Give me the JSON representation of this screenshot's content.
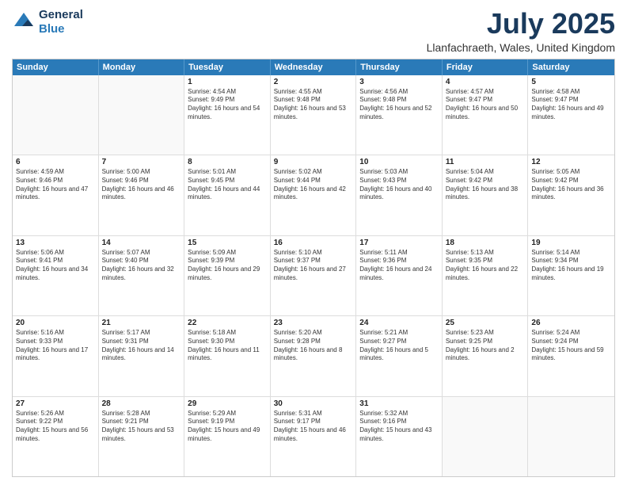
{
  "header": {
    "logo_line1": "General",
    "logo_line2": "Blue",
    "title": "July 2025",
    "subtitle": "Llanfachraeth, Wales, United Kingdom"
  },
  "weekdays": [
    "Sunday",
    "Monday",
    "Tuesday",
    "Wednesday",
    "Thursday",
    "Friday",
    "Saturday"
  ],
  "weeks": [
    [
      {
        "day": "",
        "sunrise": "",
        "sunset": "",
        "daylight": ""
      },
      {
        "day": "",
        "sunrise": "",
        "sunset": "",
        "daylight": ""
      },
      {
        "day": "1",
        "sunrise": "Sunrise: 4:54 AM",
        "sunset": "Sunset: 9:49 PM",
        "daylight": "Daylight: 16 hours and 54 minutes."
      },
      {
        "day": "2",
        "sunrise": "Sunrise: 4:55 AM",
        "sunset": "Sunset: 9:48 PM",
        "daylight": "Daylight: 16 hours and 53 minutes."
      },
      {
        "day": "3",
        "sunrise": "Sunrise: 4:56 AM",
        "sunset": "Sunset: 9:48 PM",
        "daylight": "Daylight: 16 hours and 52 minutes."
      },
      {
        "day": "4",
        "sunrise": "Sunrise: 4:57 AM",
        "sunset": "Sunset: 9:47 PM",
        "daylight": "Daylight: 16 hours and 50 minutes."
      },
      {
        "day": "5",
        "sunrise": "Sunrise: 4:58 AM",
        "sunset": "Sunset: 9:47 PM",
        "daylight": "Daylight: 16 hours and 49 minutes."
      }
    ],
    [
      {
        "day": "6",
        "sunrise": "Sunrise: 4:59 AM",
        "sunset": "Sunset: 9:46 PM",
        "daylight": "Daylight: 16 hours and 47 minutes."
      },
      {
        "day": "7",
        "sunrise": "Sunrise: 5:00 AM",
        "sunset": "Sunset: 9:46 PM",
        "daylight": "Daylight: 16 hours and 46 minutes."
      },
      {
        "day": "8",
        "sunrise": "Sunrise: 5:01 AM",
        "sunset": "Sunset: 9:45 PM",
        "daylight": "Daylight: 16 hours and 44 minutes."
      },
      {
        "day": "9",
        "sunrise": "Sunrise: 5:02 AM",
        "sunset": "Sunset: 9:44 PM",
        "daylight": "Daylight: 16 hours and 42 minutes."
      },
      {
        "day": "10",
        "sunrise": "Sunrise: 5:03 AM",
        "sunset": "Sunset: 9:43 PM",
        "daylight": "Daylight: 16 hours and 40 minutes."
      },
      {
        "day": "11",
        "sunrise": "Sunrise: 5:04 AM",
        "sunset": "Sunset: 9:42 PM",
        "daylight": "Daylight: 16 hours and 38 minutes."
      },
      {
        "day": "12",
        "sunrise": "Sunrise: 5:05 AM",
        "sunset": "Sunset: 9:42 PM",
        "daylight": "Daylight: 16 hours and 36 minutes."
      }
    ],
    [
      {
        "day": "13",
        "sunrise": "Sunrise: 5:06 AM",
        "sunset": "Sunset: 9:41 PM",
        "daylight": "Daylight: 16 hours and 34 minutes."
      },
      {
        "day": "14",
        "sunrise": "Sunrise: 5:07 AM",
        "sunset": "Sunset: 9:40 PM",
        "daylight": "Daylight: 16 hours and 32 minutes."
      },
      {
        "day": "15",
        "sunrise": "Sunrise: 5:09 AM",
        "sunset": "Sunset: 9:39 PM",
        "daylight": "Daylight: 16 hours and 29 minutes."
      },
      {
        "day": "16",
        "sunrise": "Sunrise: 5:10 AM",
        "sunset": "Sunset: 9:37 PM",
        "daylight": "Daylight: 16 hours and 27 minutes."
      },
      {
        "day": "17",
        "sunrise": "Sunrise: 5:11 AM",
        "sunset": "Sunset: 9:36 PM",
        "daylight": "Daylight: 16 hours and 24 minutes."
      },
      {
        "day": "18",
        "sunrise": "Sunrise: 5:13 AM",
        "sunset": "Sunset: 9:35 PM",
        "daylight": "Daylight: 16 hours and 22 minutes."
      },
      {
        "day": "19",
        "sunrise": "Sunrise: 5:14 AM",
        "sunset": "Sunset: 9:34 PM",
        "daylight": "Daylight: 16 hours and 19 minutes."
      }
    ],
    [
      {
        "day": "20",
        "sunrise": "Sunrise: 5:16 AM",
        "sunset": "Sunset: 9:33 PM",
        "daylight": "Daylight: 16 hours and 17 minutes."
      },
      {
        "day": "21",
        "sunrise": "Sunrise: 5:17 AM",
        "sunset": "Sunset: 9:31 PM",
        "daylight": "Daylight: 16 hours and 14 minutes."
      },
      {
        "day": "22",
        "sunrise": "Sunrise: 5:18 AM",
        "sunset": "Sunset: 9:30 PM",
        "daylight": "Daylight: 16 hours and 11 minutes."
      },
      {
        "day": "23",
        "sunrise": "Sunrise: 5:20 AM",
        "sunset": "Sunset: 9:28 PM",
        "daylight": "Daylight: 16 hours and 8 minutes."
      },
      {
        "day": "24",
        "sunrise": "Sunrise: 5:21 AM",
        "sunset": "Sunset: 9:27 PM",
        "daylight": "Daylight: 16 hours and 5 minutes."
      },
      {
        "day": "25",
        "sunrise": "Sunrise: 5:23 AM",
        "sunset": "Sunset: 9:25 PM",
        "daylight": "Daylight: 16 hours and 2 minutes."
      },
      {
        "day": "26",
        "sunrise": "Sunrise: 5:24 AM",
        "sunset": "Sunset: 9:24 PM",
        "daylight": "Daylight: 15 hours and 59 minutes."
      }
    ],
    [
      {
        "day": "27",
        "sunrise": "Sunrise: 5:26 AM",
        "sunset": "Sunset: 9:22 PM",
        "daylight": "Daylight: 15 hours and 56 minutes."
      },
      {
        "day": "28",
        "sunrise": "Sunrise: 5:28 AM",
        "sunset": "Sunset: 9:21 PM",
        "daylight": "Daylight: 15 hours and 53 minutes."
      },
      {
        "day": "29",
        "sunrise": "Sunrise: 5:29 AM",
        "sunset": "Sunset: 9:19 PM",
        "daylight": "Daylight: 15 hours and 49 minutes."
      },
      {
        "day": "30",
        "sunrise": "Sunrise: 5:31 AM",
        "sunset": "Sunset: 9:17 PM",
        "daylight": "Daylight: 15 hours and 46 minutes."
      },
      {
        "day": "31",
        "sunrise": "Sunrise: 5:32 AM",
        "sunset": "Sunset: 9:16 PM",
        "daylight": "Daylight: 15 hours and 43 minutes."
      },
      {
        "day": "",
        "sunrise": "",
        "sunset": "",
        "daylight": ""
      },
      {
        "day": "",
        "sunrise": "",
        "sunset": "",
        "daylight": ""
      }
    ]
  ]
}
